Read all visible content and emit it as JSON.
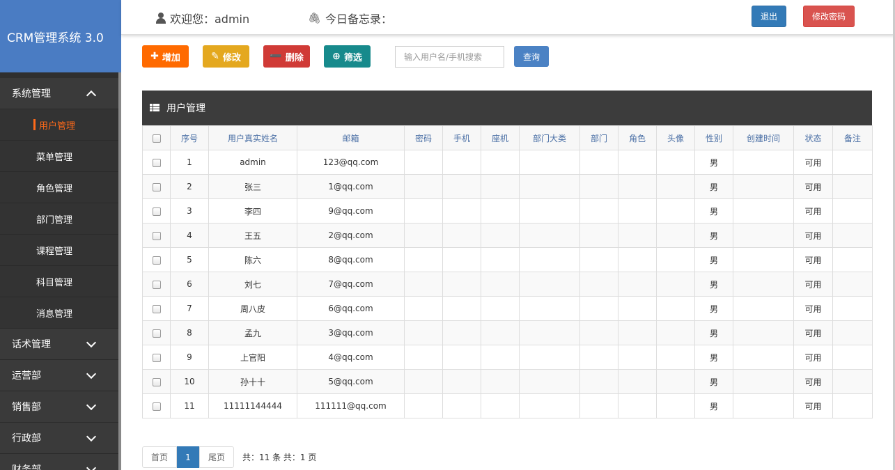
{
  "brand": "CRM管理系统 3.0",
  "sidebar": {
    "groups": [
      {
        "label": "系统管理",
        "expanded": true,
        "items": [
          "用户管理",
          "菜单管理",
          "角色管理",
          "部门管理",
          "课程管理",
          "科目管理",
          "消息管理"
        ]
      },
      {
        "label": "话术管理",
        "expanded": false
      },
      {
        "label": "运营部",
        "expanded": false
      },
      {
        "label": "销售部",
        "expanded": false
      },
      {
        "label": "行政部",
        "expanded": false
      },
      {
        "label": "财务部",
        "expanded": false
      }
    ],
    "active_item": "用户管理"
  },
  "header": {
    "welcome": "欢迎您：admin",
    "memo": "今日备忘录：",
    "logout": "退出",
    "change_password": "修改密码"
  },
  "toolbar": {
    "add": "增加",
    "edit": "修改",
    "delete": "删除",
    "filter": "筛选",
    "search_placeholder": "输入用户名/手机搜索",
    "query": "查询"
  },
  "panel": {
    "title": "用户管理"
  },
  "table": {
    "columns": [
      "序号",
      "用户真实姓名",
      "邮箱",
      "密码",
      "手机",
      "座机",
      "部门大类",
      "部门",
      "角色",
      "头像",
      "性别",
      "创建时间",
      "状态",
      "备注"
    ],
    "rows": [
      [
        "1",
        "admin",
        "123@qq.com",
        "",
        "",
        "",
        "",
        "",
        "",
        "",
        "男",
        "",
        "可用",
        ""
      ],
      [
        "2",
        "张三",
        "1@qq.com",
        "",
        "",
        "",
        "",
        "",
        "",
        "",
        "男",
        "",
        "可用",
        ""
      ],
      [
        "3",
        "李四",
        "9@qq.com",
        "",
        "",
        "",
        "",
        "",
        "",
        "",
        "男",
        "",
        "可用",
        ""
      ],
      [
        "4",
        "王五",
        "2@qq.com",
        "",
        "",
        "",
        "",
        "",
        "",
        "",
        "男",
        "",
        "可用",
        ""
      ],
      [
        "5",
        "陈六",
        "8@qq.com",
        "",
        "",
        "",
        "",
        "",
        "",
        "",
        "男",
        "",
        "可用",
        ""
      ],
      [
        "6",
        "刘七",
        "7@qq.com",
        "",
        "",
        "",
        "",
        "",
        "",
        "",
        "男",
        "",
        "可用",
        ""
      ],
      [
        "7",
        "周八皮",
        "6@qq.com",
        "",
        "",
        "",
        "",
        "",
        "",
        "",
        "男",
        "",
        "可用",
        ""
      ],
      [
        "8",
        "孟九",
        "3@qq.com",
        "",
        "",
        "",
        "",
        "",
        "",
        "",
        "男",
        "",
        "可用",
        ""
      ],
      [
        "9",
        "上官阳",
        "4@qq.com",
        "",
        "",
        "",
        "",
        "",
        "",
        "",
        "男",
        "",
        "可用",
        ""
      ],
      [
        "10",
        "孙十十",
        "5@qq.com",
        "",
        "",
        "",
        "",
        "",
        "",
        "",
        "男",
        "",
        "可用",
        ""
      ],
      [
        "11",
        "11111144444",
        "111111@qq.com",
        "",
        "",
        "",
        "",
        "",
        "",
        "",
        "男",
        "",
        "可用",
        ""
      ]
    ]
  },
  "pagination": {
    "first": "首页",
    "current": "1",
    "last": "尾页",
    "info": "共：11 条   共：1 页"
  },
  "colors": {
    "brand_bg": "#4a7cc3",
    "sidebar_bg": "#393939",
    "active_item": "#ff6a1a",
    "add": "#ff6a00",
    "edit": "#e4a81f",
    "delete": "#d03a36",
    "filter": "#178a8c"
  }
}
